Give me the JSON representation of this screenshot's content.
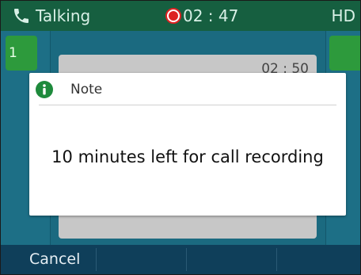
{
  "status_bar": {
    "state_label": "Talking",
    "recording_timer": "02 : 47",
    "quality_badge": "HD"
  },
  "background": {
    "line_key_label": "1",
    "card_timer": "02 : 50"
  },
  "dialog": {
    "title": "Note",
    "message": "10 minutes left for call recording"
  },
  "softkeys": {
    "cancel_label": "Cancel"
  },
  "icons": {
    "status": "phone-handset-icon",
    "recording": "record-icon",
    "dialog": "info-icon"
  },
  "colors": {
    "status_bar": "#165f40",
    "content_bg": "#1b6a80",
    "softkey_bar": "#0f3f5a",
    "line_key_active": "#2d9a3c",
    "recording": "#dd2222",
    "info_icon": "#1e8a3c"
  }
}
